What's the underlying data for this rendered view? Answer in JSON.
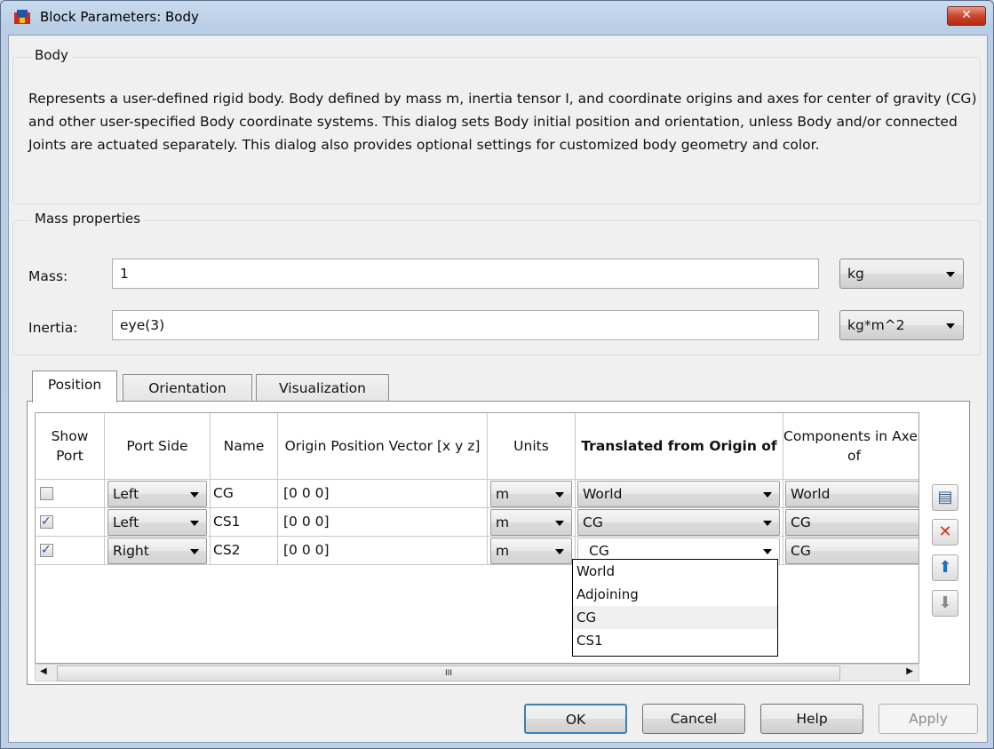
{
  "window": {
    "title": "Block Parameters: Body",
    "close_label": "✕"
  },
  "body_group": {
    "legend": "Body",
    "description": "Represents a user-defined rigid body. Body defined by mass m, inertia tensor I, and coordinate origins and axes for center of gravity (CG) and other user-specified Body coordinate systems. This dialog sets Body initial position and orientation, unless Body and/or connected Joints are actuated separately. This dialog also provides optional settings for customized body geometry and color."
  },
  "mass_group": {
    "legend": "Mass properties",
    "mass_label": "Mass:",
    "mass_value": "1",
    "mass_units": "kg",
    "inertia_label": "Inertia:",
    "inertia_value": "eye(3)",
    "inertia_units": "kg*m^2"
  },
  "tabs": [
    {
      "label": "Position",
      "active": true
    },
    {
      "label": "Orientation",
      "active": false
    },
    {
      "label": "Visualization",
      "active": false
    }
  ],
  "table": {
    "headers": {
      "show_port": "Show Port",
      "port_side": "Port Side",
      "name": "Name",
      "origin": "Origin Position Vector [x y z]",
      "units": "Units",
      "translated": "Translated from Origin of",
      "components": "Components in Axes of"
    },
    "rows": [
      {
        "show_port": false,
        "port_side": "Left",
        "name": "CG",
        "origin": "[0 0 0]",
        "units": "m",
        "translated": "World",
        "components": "World"
      },
      {
        "show_port": true,
        "port_side": "Left",
        "name": "CS1",
        "origin": "[0 0 0]",
        "units": "m",
        "translated": "CG",
        "components": "CG"
      },
      {
        "show_port": true,
        "port_side": "Right",
        "name": "CS2",
        "origin": "[0 0 0]",
        "units": "m",
        "translated": "CG",
        "components": "CG"
      }
    ],
    "dropdown_options": [
      "World",
      "Adjoining",
      "CG",
      "CS1"
    ],
    "dropdown_highlighted": "CG",
    "scroll_grip": "III"
  },
  "side_buttons": [
    {
      "name": "add-icon",
      "glyph": "▤"
    },
    {
      "name": "delete-icon",
      "glyph": "✕"
    },
    {
      "name": "move-up-icon",
      "glyph": "⬆"
    },
    {
      "name": "move-down-icon",
      "glyph": "⬇"
    }
  ],
  "buttons": {
    "ok": "OK",
    "cancel": "Cancel",
    "help": "Help",
    "apply": "Apply"
  },
  "colors": {
    "delete": "#d62b1d",
    "arrow_up": "#1f6fc2",
    "arrow_down_disabled": "#8a8a8a"
  }
}
